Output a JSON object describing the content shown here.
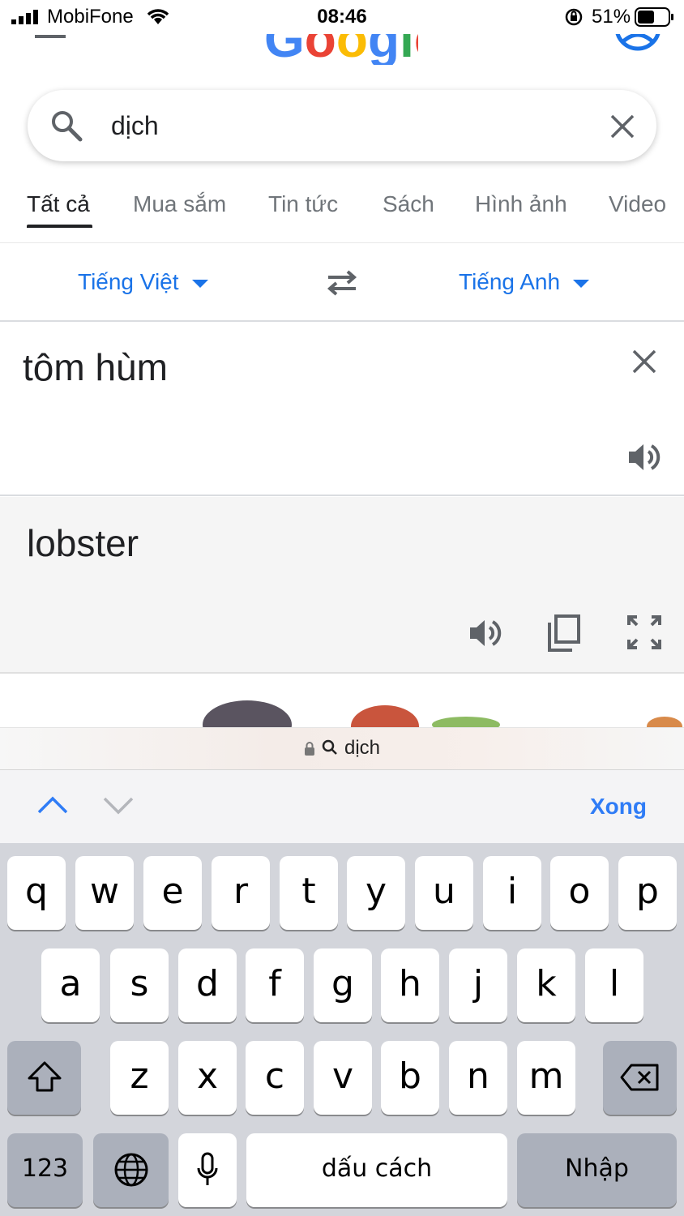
{
  "status_bar": {
    "carrier": "MobiFone",
    "time": "08:46",
    "battery": "51%"
  },
  "search": {
    "query": "dịch"
  },
  "tabs": [
    {
      "label": "Tất cả",
      "active": true
    },
    {
      "label": "Mua sắm"
    },
    {
      "label": "Tin tức"
    },
    {
      "label": "Sách"
    },
    {
      "label": "Hình ảnh"
    },
    {
      "label": "Video"
    }
  ],
  "translate": {
    "source_lang": "Tiếng Việt",
    "target_lang": "Tiếng Anh",
    "source_text": "tôm hùm",
    "translated_text": "lobster"
  },
  "url_bar": {
    "text": "dịch"
  },
  "accessory": {
    "done_label": "Xong"
  },
  "keyboard": {
    "row1": [
      "q",
      "w",
      "e",
      "r",
      "t",
      "y",
      "u",
      "i",
      "o",
      "p"
    ],
    "row2": [
      "a",
      "s",
      "d",
      "f",
      "g",
      "h",
      "j",
      "k",
      "l"
    ],
    "row3": [
      "z",
      "x",
      "c",
      "v",
      "b",
      "n",
      "m"
    ],
    "numbers_label": "123",
    "space_label": "dấu cách",
    "return_label": "Nhập"
  },
  "colors": {
    "accent": "#1a73e8",
    "done": "#2f7cf6"
  }
}
